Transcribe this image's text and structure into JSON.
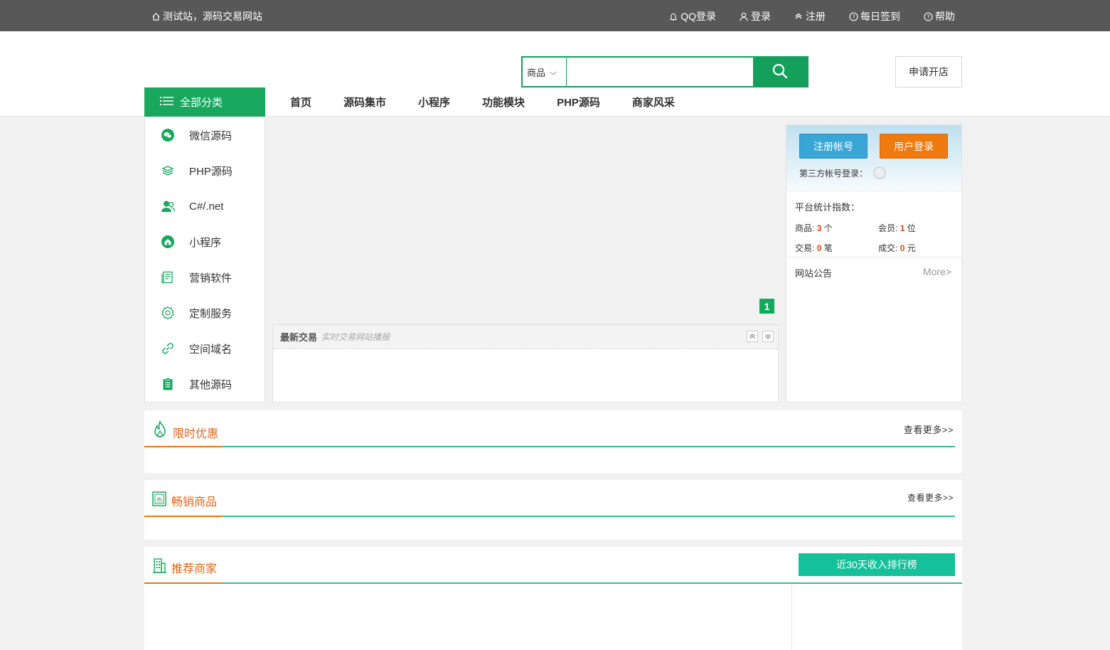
{
  "topbar": {
    "site_label": "测试站，源码交易网站",
    "links": [
      {
        "icon": "bell-icon",
        "label": "QQ登录"
      },
      {
        "icon": "user-icon",
        "label": "登录"
      },
      {
        "icon": "chevron-up-icon",
        "label": "注册"
      },
      {
        "icon": "help-circle-icon",
        "label": "每日签到"
      },
      {
        "icon": "help-circle-icon",
        "label": "帮助"
      }
    ]
  },
  "search": {
    "scope_selected": "商品",
    "query": "",
    "placeholder": ""
  },
  "apply_store_label": "申请开店",
  "all_categories_label": "全部分类",
  "nav": [
    "首页",
    "源码集市",
    "小程序",
    "功能模块",
    "PHP源码",
    "商家风采"
  ],
  "categories": [
    {
      "icon": "wechat-icon",
      "label": "微信源码"
    },
    {
      "icon": "layers-icon",
      "label": "PHP源码"
    },
    {
      "icon": "users-icon",
      "label": "C#/.net"
    },
    {
      "icon": "home-circle-icon",
      "label": "小程序"
    },
    {
      "icon": "document-icon",
      "label": "营销软件"
    },
    {
      "icon": "gear-icon",
      "label": "定制服务"
    },
    {
      "icon": "link-icon",
      "label": "空间域名"
    },
    {
      "icon": "clipboard-icon",
      "label": "其他源码"
    }
  ],
  "banner": {
    "page_indicator": "1"
  },
  "latest_trades": {
    "title": "最新交易",
    "subtitle": "实时交易网站播报"
  },
  "user_panel": {
    "register_label": "注册帐号",
    "login_label": "用户登录",
    "third_party_label": "第三方帐号登录："
  },
  "stats": {
    "heading": "平台统计指数：",
    "items": [
      {
        "label": "商品:",
        "value": "3",
        "unit": "个"
      },
      {
        "label": "会员:",
        "value": "1",
        "unit": "位"
      },
      {
        "label": "交易:",
        "value": "0",
        "unit": "笔"
      },
      {
        "label": "成交:",
        "value": "0",
        "unit": "元"
      }
    ]
  },
  "notice": {
    "title": "网站公告",
    "more": "More>"
  },
  "sections": {
    "limited": {
      "title": "限时优惠",
      "more": "查看更多>>"
    },
    "hot": {
      "title": "畅销商品",
      "more": "查看更多>>"
    },
    "merchants": {
      "title": "推荐商家",
      "rank_button": "近30天收入排行榜"
    }
  },
  "colors": {
    "topbar": "#585858",
    "brand_green": "#17a85e",
    "teal": "#15c19a",
    "orange": "#ef7a0e",
    "stat_value": "#e0440e"
  }
}
